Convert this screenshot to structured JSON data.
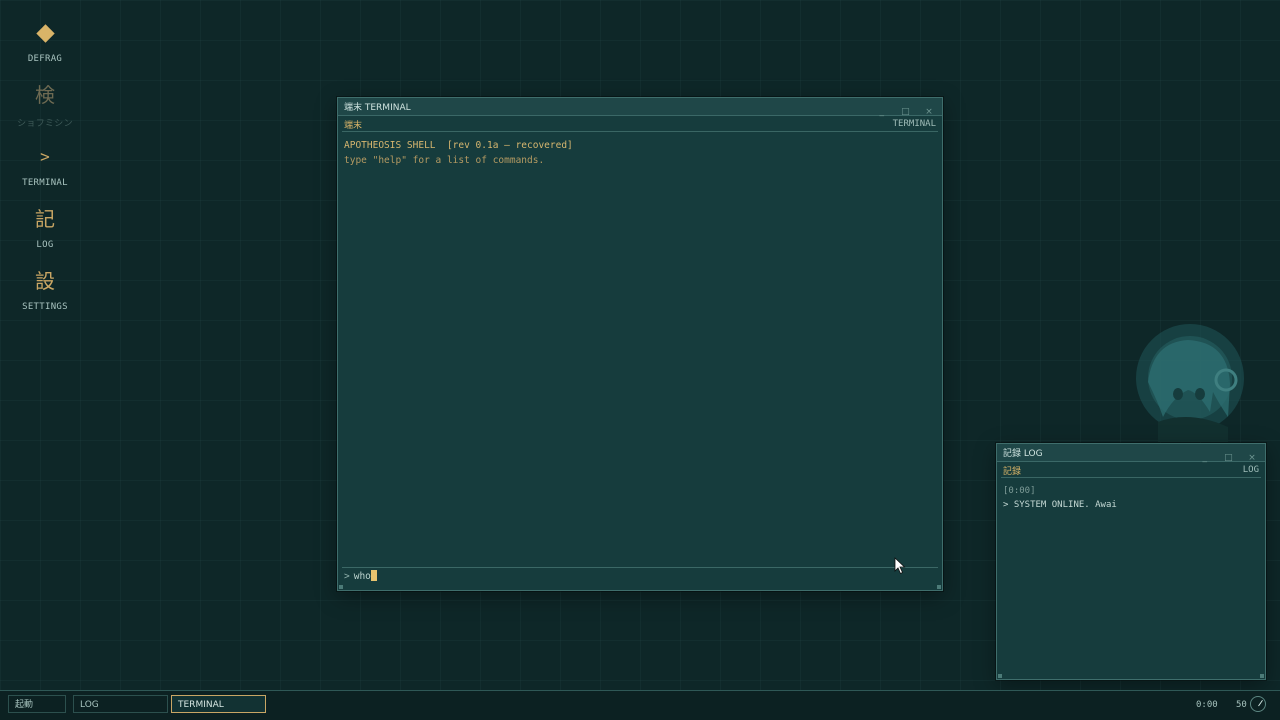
{
  "desktop": {
    "icons": [
      {
        "glyph": "◆",
        "label": "DEFRAG"
      },
      {
        "glyph": "検",
        "label": "ショフミシン"
      },
      {
        "glyph": ">",
        "label": "TERMINAL"
      },
      {
        "glyph": "記",
        "label": "LOG"
      },
      {
        "glyph": "設",
        "label": "SETTINGS"
      }
    ]
  },
  "terminal_window": {
    "title": "端末 TERMINAL",
    "sub_left": "端末",
    "sub_right": "TERMINAL",
    "controls": {
      "minimize": "_",
      "maximize": "□",
      "close": "×"
    },
    "lines": [
      "APOTHEOSIS SHELL  [rev 0.1a — recovered]",
      "type \"help\" for a list of commands."
    ],
    "prompt_symbol": ">",
    "input_value": "who"
  },
  "log_window": {
    "title": "記録 LOG",
    "sub_left": "記録",
    "sub_right": "LOG",
    "controls": {
      "minimize": "_",
      "maximize": "□",
      "close": "×"
    },
    "lines": [
      {
        "time": "[0:00]",
        "text": "> SYSTEM ONLINE. Awai"
      }
    ]
  },
  "taskbar": {
    "start_label": "起動",
    "buttons": [
      "LOG",
      "TERMINAL"
    ],
    "active": "TERMINAL",
    "clock": "0:00",
    "fps": "50"
  },
  "colors": {
    "background": "#0e2728",
    "window": "#163c3d",
    "accent": "#d9b468"
  }
}
